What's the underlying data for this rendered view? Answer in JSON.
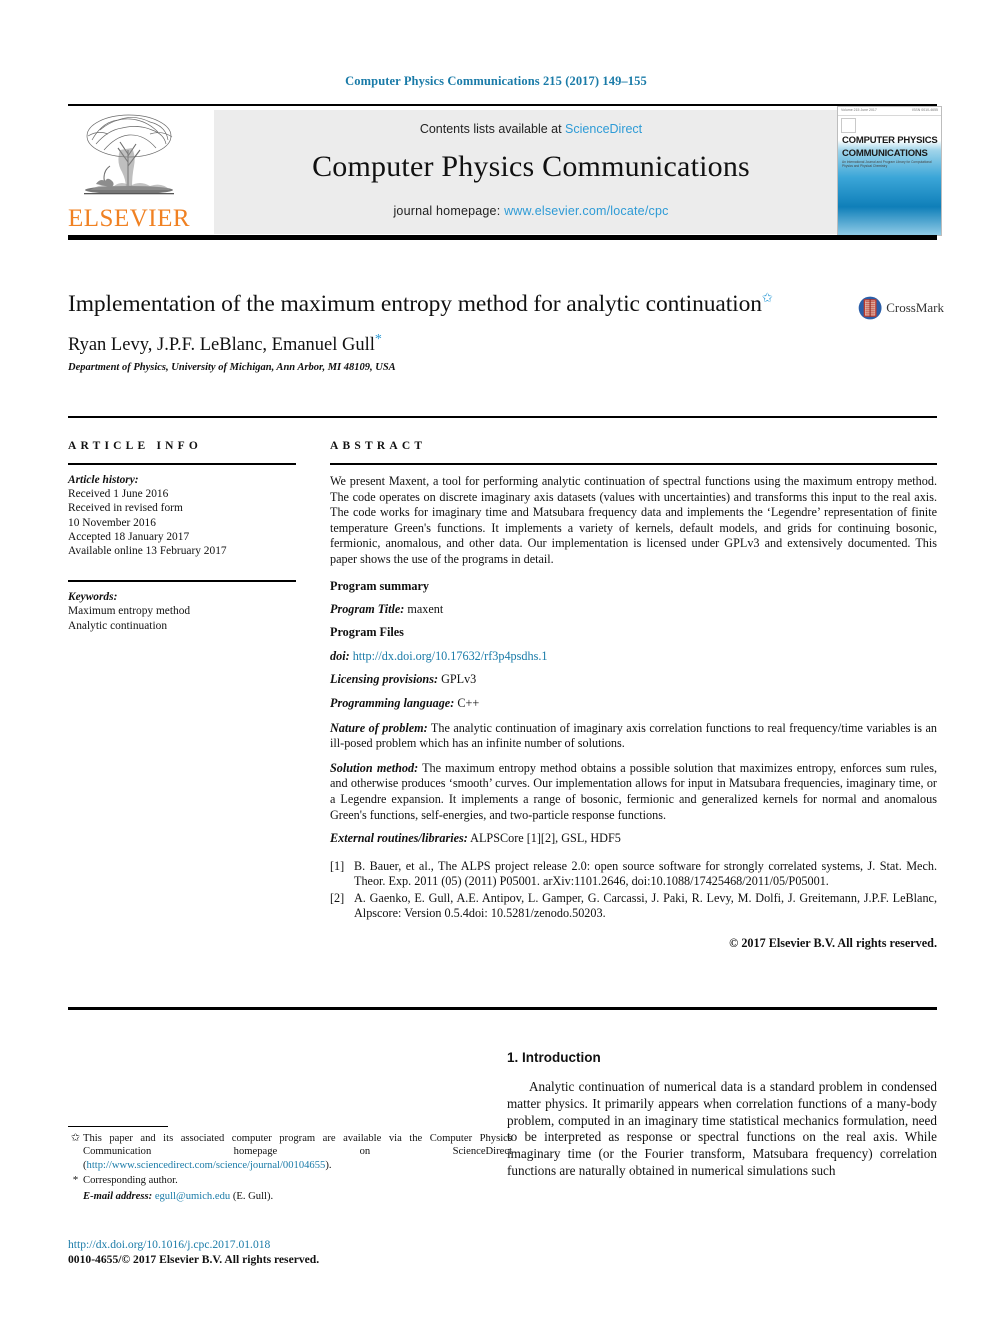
{
  "running_head": "Computer Physics Communications 215 (2017) 149–155",
  "journal_header": {
    "publisher_name": "ELSEVIER",
    "contents_prefix": "Contents lists available at ",
    "contents_link": "ScienceDirect",
    "journal_title": "Computer Physics Communications",
    "homepage_prefix": "journal homepage: ",
    "homepage_link": "www.elsevier.com/locate/cpc",
    "cover": {
      "title_line1": "COMPUTER PHYSICS",
      "title_line2": "COMMUNICATIONS",
      "subtitle": "An International Journal and Program Library for Computational Physics and Physical Chemistry",
      "top_left": "Volume 215  June 2017",
      "top_right": "ISSN 0010-4655"
    }
  },
  "article": {
    "title": "Implementation of the maximum entropy method for analytic continuation",
    "title_marker": "✩",
    "authors": "Ryan Levy, J.P.F. LeBlanc, Emanuel Gull",
    "author_marker": "*",
    "affiliation": "Department of Physics, University of Michigan, Ann Arbor, MI 48109, USA",
    "crossmark_label": "CrossMark"
  },
  "article_info": {
    "heading": "ARTICLE INFO",
    "history_label": "Article history:",
    "history": [
      "Received 1 June 2016",
      "Received in revised form",
      "10 November 2016",
      "Accepted 18 January 2017",
      "Available online 13 February 2017"
    ],
    "keywords_label": "Keywords:",
    "keywords": [
      "Maximum entropy method",
      "Analytic continuation"
    ]
  },
  "abstract": {
    "heading": "ABSTRACT",
    "text": "We present Maxent, a tool for performing analytic continuation of spectral functions using the maximum entropy method. The code operates on discrete imaginary axis datasets (values with uncertainties) and transforms this input to the real axis. The code works for imaginary time and Matsubara frequency data and implements the ‘Legendre’ representation of finite temperature Green's functions. It implements a variety of kernels, default models, and grids for continuing bosonic, fermionic, anomalous, and other data. Our implementation is licensed under GPLv3 and extensively documented. This paper shows the use of the programs in detail.",
    "program_summary_heading": "Program summary",
    "fields": [
      {
        "label": "Program Title:",
        "value": " maxent"
      },
      {
        "label": "Program Files",
        "value": ""
      },
      {
        "label": "doi:",
        "value": " http://dx.doi.org/10.17632/rf3p4psdhs.1",
        "link": true
      },
      {
        "label": "Licensing provisions:",
        "value": " GPLv3"
      },
      {
        "label": "Programming language:",
        "value": " C++"
      }
    ],
    "nature_label": "Nature of problem:",
    "nature_text": " The analytic continuation of imaginary axis correlation functions to real frequency/time variables is an ill-posed problem which has an infinite number of solutions.",
    "solution_label": "Solution method:",
    "solution_text": " The maximum entropy method obtains a possible solution that maximizes entropy, enforces sum rules, and otherwise produces ‘smooth’ curves. Our implementation allows for input in Matsubara frequencies, imaginary time, or a Legendre expansion. It implements a range of bosonic, fermionic and generalized kernels for normal and anomalous Green's functions, self-energies, and two-particle response functions.",
    "external_label": "External routines/libraries:",
    "external_text": " ALPSCore [1][2], GSL, HDF5",
    "references": [
      {
        "num": "[1]",
        "text": "B. Bauer, et al., The ALPS project release 2.0: open source software for strongly correlated systems, J. Stat. Mech. Theor. Exp. 2011 (05) (2011) P05001. arXiv:1101.2646, doi:10.1088/17425468/2011/05/P05001."
      },
      {
        "num": "[2]",
        "text": "A. Gaenko, E. Gull, A.E. Antipov, L. Gamper, G. Carcassi, J. Paki, R. Levy, M. Dolfi, J. Greitemann, J.P.F. LeBlanc, Alpscore: Version 0.5.4doi: 10.5281/zenodo.50203."
      }
    ],
    "copyright": "© 2017 Elsevier B.V. All rights reserved."
  },
  "body": {
    "section_heading": "1. Introduction",
    "paragraph": "Analytic continuation of numerical data is a standard problem in condensed matter physics. It primarily appears when correlation functions of a many-body problem, computed in an imaginary time statistical mechanics formulation, need to be interpreted as response or spectral functions on the real axis. While imaginary time (or the Fourier transform, Matsubara frequency) correlation functions are naturally obtained in numerical simulations such"
  },
  "footnotes": {
    "star_mark": "✩",
    "star_text_1": "This paper and its associated computer program are available via the Computer Physics Communication homepage on ScienceDirect   (",
    "star_link": "http://www.sciencedirect.com/science/journal/00104655",
    "star_text_2": ").",
    "corresponding_mark": "*",
    "corresponding_text": "Corresponding author.",
    "email_label": "E-mail address:",
    "email_link": "egull@umich.edu",
    "email_suffix": " (E. Gull).",
    "doi_link": "http://dx.doi.org/10.1016/j.cpc.2017.01.018",
    "issn_rights": "0010-4655/© 2017 Elsevier B.V. All rights reserved."
  },
  "colors": {
    "link_blue": "#1a7ba8",
    "sciencedirect_blue": "#2e9bd6",
    "elsevier_orange": "#f08122",
    "band_gray": "#ececec"
  }
}
